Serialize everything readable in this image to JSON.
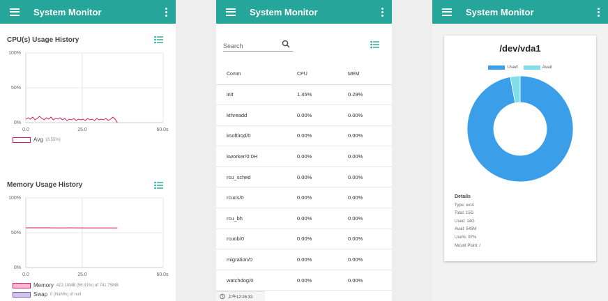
{
  "app": {
    "title": "System Monitor"
  },
  "cpu": {
    "title": "CPU(s) Usage History",
    "y_ticks": [
      "100%",
      "50%",
      "0%"
    ],
    "x_ticks": [
      "0.0",
      "25.0",
      "60.0s"
    ],
    "legend": [
      {
        "label": "Avg",
        "value": "(3.55%)",
        "color": "#d81b60"
      }
    ]
  },
  "memory": {
    "title": "Memory Usage History",
    "y_ticks": [
      "100%",
      "50%",
      "0%"
    ],
    "x_ticks": [
      "0.0",
      "25.0",
      "60.0s"
    ],
    "legend": [
      {
        "label": "Memory",
        "value": "422.10MB (56.91%) of 741.75MB",
        "color": "#d81b60"
      },
      {
        "label": "Swap",
        "value": "0 (NaN%) of null",
        "color": "#7e57c2"
      }
    ]
  },
  "chart_data": [
    {
      "type": "line",
      "title": "CPU(s) Usage History",
      "xlabel": "",
      "ylabel": "",
      "xlim": [
        0,
        60
      ],
      "ylim": [
        0,
        100
      ],
      "series": [
        {
          "name": "Avg",
          "x": [
            0,
            1,
            2,
            3,
            4,
            5,
            6,
            7,
            8,
            9,
            10,
            11,
            12,
            13,
            14,
            15,
            16,
            17,
            18,
            19,
            20,
            21,
            22,
            23,
            24,
            25,
            26,
            27,
            28,
            29,
            30,
            31,
            32,
            33,
            34,
            35,
            36,
            37,
            38,
            39,
            40
          ],
          "values": [
            5,
            7,
            5,
            8,
            4,
            6,
            9,
            6,
            4,
            7,
            5,
            8,
            4,
            6,
            5,
            7,
            4,
            6,
            3,
            5,
            4,
            6,
            3,
            5,
            4,
            5,
            3,
            6,
            4,
            5,
            3,
            6,
            4,
            5,
            4,
            6,
            3,
            5,
            8,
            5,
            0
          ]
        }
      ]
    },
    {
      "type": "line",
      "title": "Memory Usage History",
      "xlabel": "",
      "ylabel": "",
      "xlim": [
        0,
        60
      ],
      "ylim": [
        0,
        100
      ],
      "series": [
        {
          "name": "Memory",
          "x": [
            0,
            5,
            10,
            15,
            20,
            25,
            30,
            35,
            40
          ],
          "values": [
            57,
            57,
            57,
            56.9,
            57,
            56.9,
            56.9,
            56.9,
            56.9
          ]
        },
        {
          "name": "Swap",
          "x": [],
          "values": []
        }
      ]
    },
    {
      "type": "pie",
      "title": "/dev/vda1",
      "categories": [
        "Used",
        "Avail"
      ],
      "values": [
        97,
        3
      ],
      "colors": [
        "#3b9ee8",
        "#80deea"
      ]
    }
  ],
  "processes": {
    "search_placeholder": "Search",
    "columns": [
      "Comm",
      "CPU",
      "MEM"
    ],
    "rows": [
      [
        "init",
        "1.45%",
        "0.29%"
      ],
      [
        "kthreadd",
        "0.00%",
        "0.00%"
      ],
      [
        "ksoftirqd/0",
        "0.00%",
        "0.00%"
      ],
      [
        "kworker/0:0H",
        "0.00%",
        "0.00%"
      ],
      [
        "rcu_sched",
        "0.00%",
        "0.00%"
      ],
      [
        "rcuos/0",
        "0.00%",
        "0.00%"
      ],
      [
        "rcu_bh",
        "0.00%",
        "0.00%"
      ],
      [
        "rcuob/0",
        "0.00%",
        "0.00%"
      ],
      [
        "migration/0",
        "0.00%",
        "0.00%"
      ],
      [
        "watchdog/0",
        "0.00%",
        "0.00%"
      ]
    ],
    "timestamp": "上午12:26:33"
  },
  "disk": {
    "name": "/dev/vda1",
    "legend": [
      {
        "label": "Used",
        "color": "#3b9ee8"
      },
      {
        "label": "Avail",
        "color": "#80deea"
      }
    ],
    "details_title": "Details",
    "details": [
      "Type: ext4",
      "Total: 15G",
      "Used: 14G",
      "Avail: 545M",
      "Use%: 97%",
      "Mount Point: /"
    ]
  },
  "colors": {
    "appbar": "#26a69a",
    "accent": "#26a69a"
  }
}
